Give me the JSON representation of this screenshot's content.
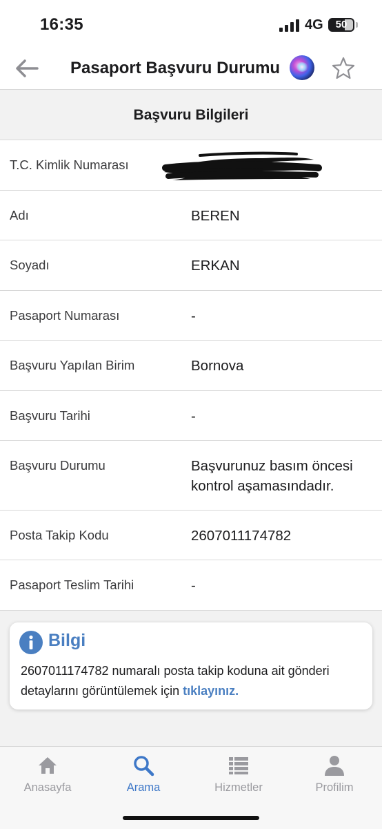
{
  "status_bar": {
    "time": "16:35",
    "network": "4G",
    "battery_level": "50",
    "battery_fraction": 0.5
  },
  "nav": {
    "title": "Pasaport Başvuru Durumu",
    "back_icon": "arrow-left-icon",
    "star_icon": "star-outline-icon"
  },
  "section": {
    "title": "Başvuru Bilgileri"
  },
  "rows": [
    {
      "label": "T.C. Kimlik Numarası",
      "value": "",
      "redacted": true
    },
    {
      "label": "Adı",
      "value": "BEREN"
    },
    {
      "label": "Soyadı",
      "value": "ERKAN"
    },
    {
      "label": "Pasaport Numarası",
      "value": "-"
    },
    {
      "label": "Başvuru Yapılan Birim",
      "value": "Bornova"
    },
    {
      "label": "Başvuru Tarihi",
      "value": "-"
    },
    {
      "label": "Başvuru Durumu",
      "value": "Başvurunuz basım öncesi kontrol aşamasındadır."
    },
    {
      "label": "Posta Takip Kodu",
      "value": "2607011174782"
    },
    {
      "label": "Pasaport Teslim Tarihi",
      "value": "-"
    }
  ],
  "info": {
    "title": "Bilgi",
    "text": "2607011174782 numaralı posta takip koduna ait gönderi detaylarını görüntülemek için ",
    "link": "tıklayınız."
  },
  "tabs": [
    {
      "label": "Anasayfa",
      "icon": "home-icon",
      "active": false
    },
    {
      "label": "Arama",
      "icon": "search-icon",
      "active": true
    },
    {
      "label": "Hizmetler",
      "icon": "list-icon",
      "active": false
    },
    {
      "label": "Profilim",
      "icon": "user-icon",
      "active": false
    }
  ],
  "colors": {
    "accent": "#4a7fc1",
    "tab_active": "#3e78c8",
    "tab_inactive": "#9a9a9f",
    "background": "#f2f2f2"
  }
}
